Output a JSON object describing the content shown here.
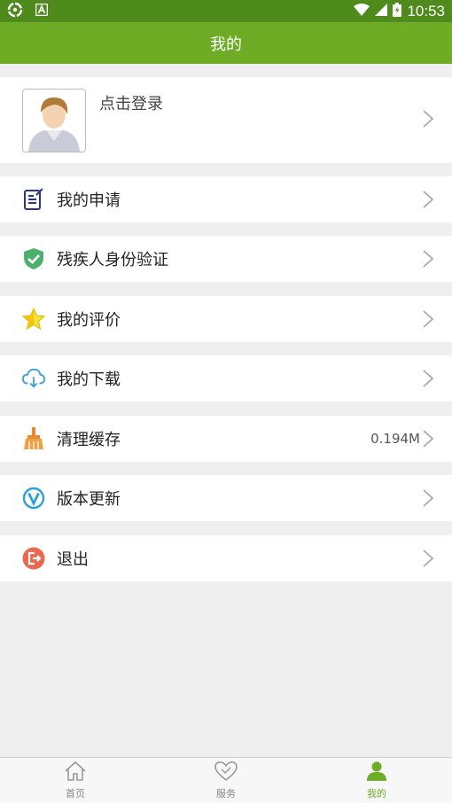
{
  "status_bar": {
    "time": "10:53",
    "left_icons": [
      "sync-icon",
      "a-notification-icon"
    ],
    "right_icons": [
      "wifi-icon",
      "signal-icon",
      "battery-icon"
    ]
  },
  "header": {
    "title": "我的"
  },
  "profile": {
    "login_text": "点击登录",
    "avatar_icon": "user-avatar-icon"
  },
  "menu": {
    "items": [
      {
        "label": "我的申请",
        "icon": "application-form-icon"
      },
      {
        "label": "残疾人身份验证",
        "icon": "verified-shield-icon"
      },
      {
        "label": "我的评价",
        "icon": "star-rating-icon"
      },
      {
        "label": "我的下载",
        "icon": "cloud-download-icon"
      },
      {
        "label": "清理缓存",
        "icon": "broom-icon",
        "value": "0.194M"
      },
      {
        "label": "版本更新",
        "icon": "version-update-icon"
      },
      {
        "label": "退出",
        "icon": "logout-icon"
      }
    ]
  },
  "tabbar": {
    "tabs": [
      {
        "label": "首页",
        "icon": "home-icon",
        "active": false
      },
      {
        "label": "服务",
        "icon": "heart-icon",
        "active": false
      },
      {
        "label": "我的",
        "icon": "person-icon",
        "active": true
      }
    ]
  },
  "colors": {
    "header": "#6fac25",
    "status_bar": "#4e8a1c",
    "active_tab": "#6fac25",
    "page_bg": "#efefef"
  }
}
